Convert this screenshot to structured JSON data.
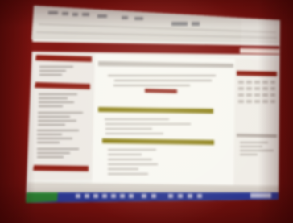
{
  "scene": {
    "subject": "projected-web-page",
    "colors": {
      "wall": "#8c1612",
      "screen_white": "#f4f3ee",
      "page_maroon": "#8b2217",
      "olive_bar": "#8a7f1e",
      "taskbar_blue": "#2d3f9e",
      "text_gray": "#b0aaa3"
    }
  }
}
